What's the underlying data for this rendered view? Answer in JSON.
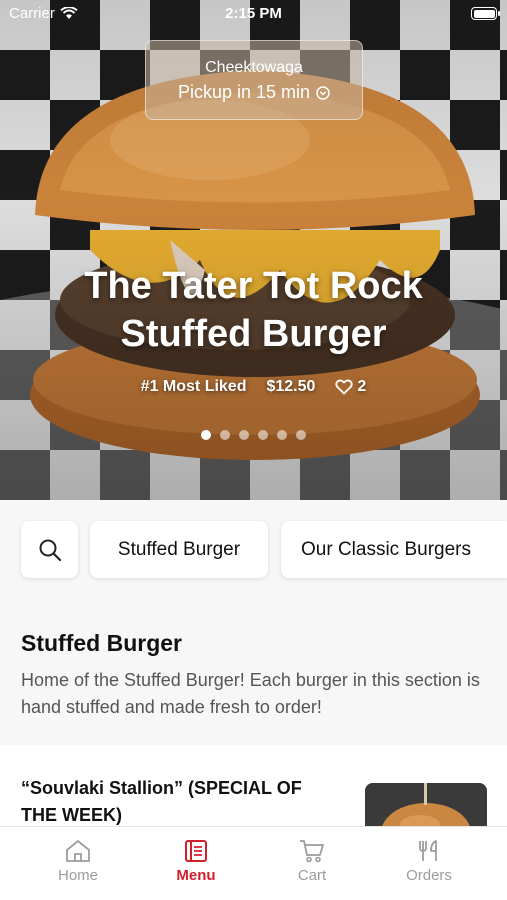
{
  "status_bar": {
    "carrier": "Carrier",
    "time": "2:15 PM"
  },
  "location": {
    "name": "Cheektowaga",
    "pickup": "Pickup in 15 min"
  },
  "hero": {
    "title": "The Tater Tot Rock Stuffed Burger",
    "rank": "#1 Most Liked",
    "price": "$12.50",
    "likes": "2",
    "slide_count": 6,
    "active_slide": 1
  },
  "categories": [
    "Stuffed Burger",
    "Our Classic Burgers"
  ],
  "section": {
    "title": "Stuffed Burger",
    "description": "Home of the Stuffed Burger! Each burger in this section is hand stuffed and made fresh to order!"
  },
  "item": {
    "name": "“Souvlaki Stallion” (SPECIAL OF THE WEEK)"
  },
  "tabs": [
    {
      "label": "Home",
      "icon": "home-icon"
    },
    {
      "label": "Menu",
      "icon": "menu-book-icon",
      "active": true
    },
    {
      "label": "Cart",
      "icon": "cart-icon"
    },
    {
      "label": "Orders",
      "icon": "fork-knife-icon"
    }
  ],
  "colors": {
    "accent": "#d0202b",
    "inactive_tab": "#9c9c9c"
  }
}
